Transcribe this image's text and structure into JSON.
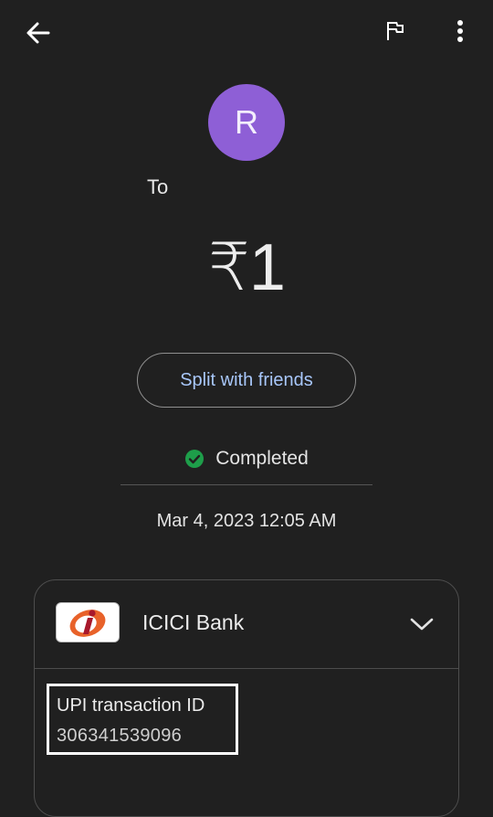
{
  "header": {
    "back_icon": "arrow-left-icon",
    "flag_icon": "flag-icon",
    "more_icon": "more-vertical-icon"
  },
  "payee": {
    "avatar_initial": "R",
    "avatar_color": "#8e5fd6",
    "to_label": "To"
  },
  "payment": {
    "amount": "₹1"
  },
  "actions": {
    "split_label": "Split with friends",
    "split_color": "#a8c7fa"
  },
  "status": {
    "text": "Completed",
    "icon": "check-circle-icon",
    "color": "#1e9e4a"
  },
  "timestamp": "Mar 4, 2023 12:05 AM",
  "bank": {
    "name": "ICICI Bank",
    "logo_icon": "icici-logo-icon",
    "expand_icon": "chevron-down-icon",
    "transaction": {
      "label": "UPI transaction ID",
      "value": "306341539096"
    }
  }
}
